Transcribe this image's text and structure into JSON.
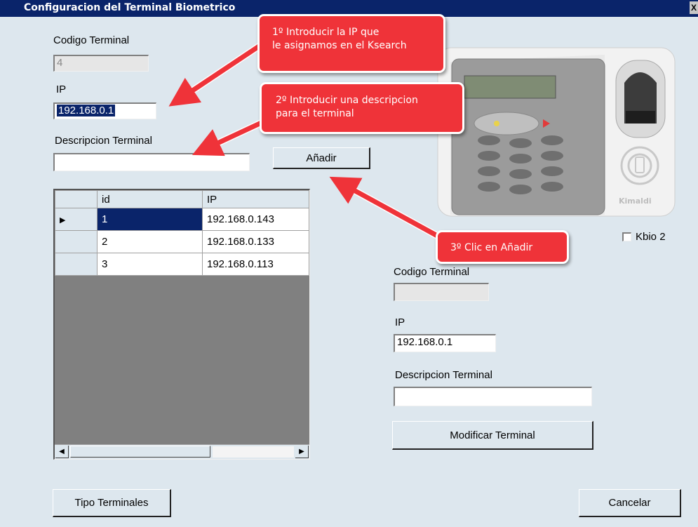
{
  "window": {
    "title": "Configuracion del Terminal Biometrico",
    "close_label": "X"
  },
  "form": {
    "codigo_label": "Codigo Terminal",
    "codigo_value": "4",
    "ip_label": "IP",
    "ip_value": "192.168.0.1",
    "descripcion_label": "Descripcion Terminal",
    "descripcion_value": "",
    "add_button": "Añadir"
  },
  "grid": {
    "columns": [
      "id",
      "IP"
    ],
    "rows": [
      {
        "id": "1",
        "ip": "192.168.0.143"
      },
      {
        "id": "2",
        "ip": "192.168.0.133"
      },
      {
        "id": "3",
        "ip": "192.168.0.113"
      }
    ],
    "current_row_marker": "▶"
  },
  "detail": {
    "kbio_label": "Kbio 2",
    "kbio_checked": false,
    "codigo_label": "Codigo  Terminal",
    "codigo_value": "",
    "ip_label": "IP",
    "ip_value": "192.168.0.1",
    "descripcion_label": "Descripcion Terminal",
    "descripcion_value": "",
    "modify_button": "Modificar Terminal"
  },
  "footer": {
    "tipo_button": "Tipo Terminales",
    "cancel_button": "Cancelar"
  },
  "device": {
    "brand": "Kimaldi"
  },
  "callouts": {
    "step1": [
      "1º Introducir la IP que",
      "le asignamos en el Ksearch"
    ],
    "step2": [
      "2º Introducir una descripcion",
      "para el terminal"
    ],
    "step3": "3º Clic en Añadir"
  },
  "colors": {
    "callout_red": "#ef3339",
    "titlebar": "#0a246a",
    "window_bg": "#dde7ee"
  }
}
